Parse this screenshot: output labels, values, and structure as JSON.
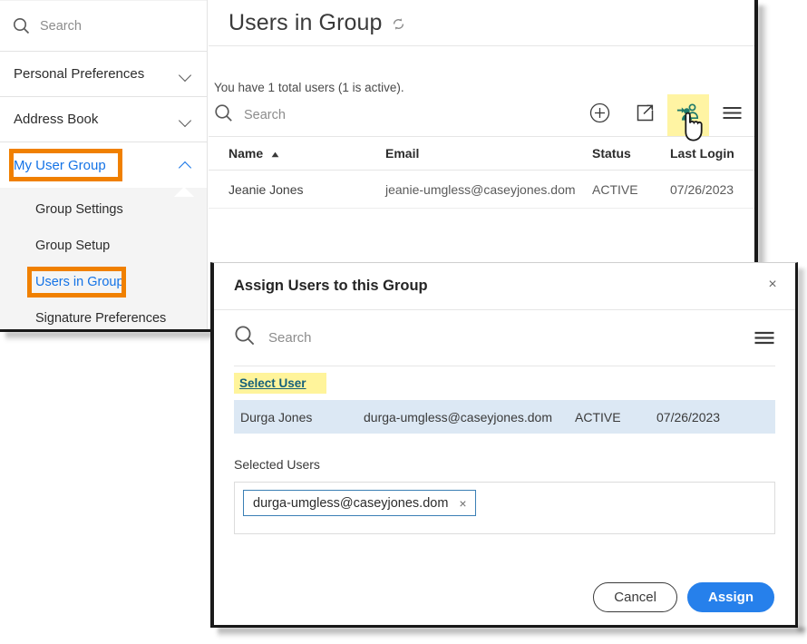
{
  "colors": {
    "accent_blue": "#1473e6",
    "highlight_orange": "#f08000",
    "highlight_yellow": "#fff49b",
    "row_selected_blue": "#dce8f4",
    "primary_button": "#2680eb",
    "icon_teal": "#1f7a6a"
  },
  "sidebar": {
    "search": {
      "placeholder": "Search",
      "icon": "search-icon"
    },
    "groups": [
      {
        "label": "Personal Preferences",
        "icon": "chevron-down-icon",
        "expanded": false,
        "highlighted": false
      },
      {
        "label": "Address Book",
        "icon": "chevron-down-icon",
        "expanded": false,
        "highlighted": false
      },
      {
        "label": "My User Group",
        "icon": "chevron-up-icon",
        "expanded": true,
        "highlighted": true
      }
    ],
    "submenu": [
      {
        "label": "Group Settings",
        "selected": false
      },
      {
        "label": "Group Setup",
        "selected": false
      },
      {
        "label": "Users in Group",
        "selected": true
      },
      {
        "label": "Signature Preferences",
        "selected": false
      }
    ]
  },
  "main": {
    "page_title": "Users in Group",
    "refresh_icon": "refresh-icon",
    "count_text": "You have 1 total users (1 is active).",
    "search": {
      "placeholder": "Search",
      "icon": "search-icon"
    },
    "toolbar_icons": [
      {
        "name": "add-user-icon",
        "glyph": "plus-circle",
        "highlighted": false
      },
      {
        "name": "export-icon",
        "glyph": "share-box",
        "highlighted": false
      },
      {
        "name": "assign-users-to-group-icon",
        "glyph": "users-arrow",
        "highlighted": true
      },
      {
        "name": "list-options-icon",
        "glyph": "hamburger",
        "highlighted": false
      }
    ],
    "table": {
      "columns": [
        "Name",
        "Email",
        "Status",
        "Last Login"
      ],
      "sort_column": "Name",
      "sort_direction": "ascending",
      "sort_icon": "sort-ascending-triangle-icon",
      "rows": [
        {
          "name": "Jeanie Jones",
          "email": "jeanie-umgless@caseyjones.dom",
          "status": "ACTIVE",
          "last_login": "07/26/2023"
        }
      ]
    }
  },
  "dialog": {
    "title": "Assign Users to this Group",
    "close_label": "×",
    "close_icon": "close-icon",
    "search": {
      "placeholder": "Search",
      "icon": "search-icon"
    },
    "options_icon": "hamburger-icon",
    "select_user_link": "Select User",
    "results": [
      {
        "name": "Durga Jones",
        "email": "durga-umgless@caseyjones.dom",
        "status": "ACTIVE",
        "last_login": "07/26/2023",
        "selected": true
      }
    ],
    "selected_users_label": "Selected Users",
    "chips": [
      {
        "text": "durga-umgless@caseyjones.dom",
        "remove_label": "×"
      }
    ],
    "cancel_label": "Cancel",
    "assign_label": "Assign"
  },
  "cursor": {
    "type": "pointing-hand-cursor"
  }
}
